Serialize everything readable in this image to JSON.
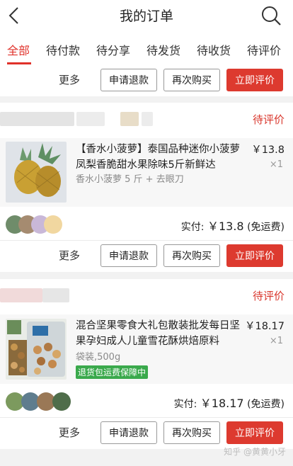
{
  "header": {
    "title": "我的订单",
    "back_icon": "back-chevron-icon",
    "search_icon": "search-icon"
  },
  "tabs": [
    {
      "label": "全部",
      "active": true
    },
    {
      "label": "待付款"
    },
    {
      "label": "待分享"
    },
    {
      "label": "待发货"
    },
    {
      "label": "待收货"
    },
    {
      "label": "待评价"
    }
  ],
  "actions": {
    "more": "更多",
    "refund": "申请退款",
    "rebuy": "再次购买",
    "review": "立即评价"
  },
  "orders": [
    {
      "status": "待评价",
      "product": {
        "title": "【香水小菠萝】泰国品种迷你小菠萝凤梨香脆甜水果除味5斤新鲜达",
        "spec": "香水小菠萝 5 斤 + 去眼刀",
        "price": "￥13.8",
        "qty": "×1"
      },
      "paid_label": "实付:",
      "paid_amount": "￥13.8",
      "paid_note": "(免运费)"
    },
    {
      "status": "待评价",
      "product": {
        "title": "混合坚果零食大礼包散装批发每日坚果孕妇成人儿童雪花酥烘焙原料",
        "spec": "袋装,500g",
        "badge": "退货包运费保障中",
        "price": "￥18.17",
        "qty": "×1"
      },
      "paid_label": "实付:",
      "paid_amount": "￥18.17",
      "paid_note": "(免运费)"
    }
  ],
  "watermark": "知乎 @黄黄小牙",
  "colors": {
    "accent": "#e0312a",
    "primary_button": "#dd3a2f",
    "badge": "#3aa94c"
  }
}
